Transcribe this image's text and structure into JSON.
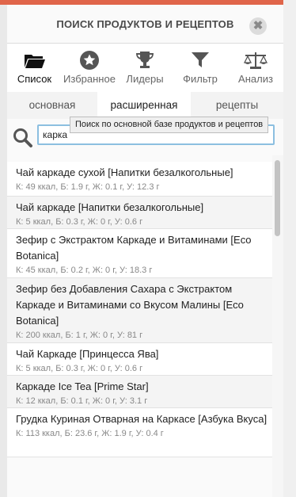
{
  "header": {
    "title": "ПОИСК ПРОДУКТОВ И РЕЦЕПТОВ",
    "close_symbol": "✖"
  },
  "tabs": [
    {
      "label": "Список",
      "icon": "folder-icon",
      "active": true
    },
    {
      "label": "Избранное",
      "icon": "star-icon",
      "active": false
    },
    {
      "label": "Лидеры",
      "icon": "trophy-icon",
      "active": false
    },
    {
      "label": "Фильтр",
      "icon": "filter-icon",
      "active": false
    },
    {
      "label": "Анализ",
      "icon": "scales-icon",
      "active": false
    }
  ],
  "subtabs": [
    {
      "label": "основная",
      "active": false
    },
    {
      "label": "расширенная",
      "active": true
    },
    {
      "label": "рецепты",
      "active": false
    }
  ],
  "search": {
    "value": "карка",
    "tooltip": "Поиск по основной базе продуктов и рецептов"
  },
  "results": [
    {
      "name": "Чай каркаде сухой [Напитки безалкогольные]",
      "nutrition": "К: 49 ккал, Б: 1.9 г, Ж: 0.1 г, У: 12.3 г"
    },
    {
      "name": "Чай каркаде [Напитки безалкогольные]",
      "nutrition": "К: 5 ккал, Б: 0.3 г, Ж: 0 г, У: 0.6 г"
    },
    {
      "name": "Зефир с Экстрактом Каркаде и Витаминами [Eco Botanica]",
      "nutrition": "К: 45 ккал, Б: 0.2 г, Ж: 0 г, У: 18.3 г"
    },
    {
      "name": "Зефир без Добавления Сахара с Экстрактом Каркаде и Витаминами со Вкусом Малины [Eco Botanica]",
      "nutrition": "К: 200 ккал, Б: 1 г, Ж: 0 г, У: 81 г"
    },
    {
      "name": "Чай Каркаде [Принцесса Ява]",
      "nutrition": "К: 5 ккал, Б: 0.3 г, Ж: 0 г, У: 0.6 г"
    },
    {
      "name": "Каркаде Ice Tea [Prime Star]",
      "nutrition": "К: 12 ккал, Б: 0.1 г, Ж: 0 г, У: 3.1 г"
    },
    {
      "name": "Грудка Куриная Отварная на Каркасе [Азбука Вкуса]",
      "nutrition": "К: 113 ккал, Б: 23.6 г, Ж: 1.9 г, У: 0.4 г"
    }
  ],
  "colors": {
    "accent": "#e0654a",
    "input_border": "#8cbfe0"
  }
}
